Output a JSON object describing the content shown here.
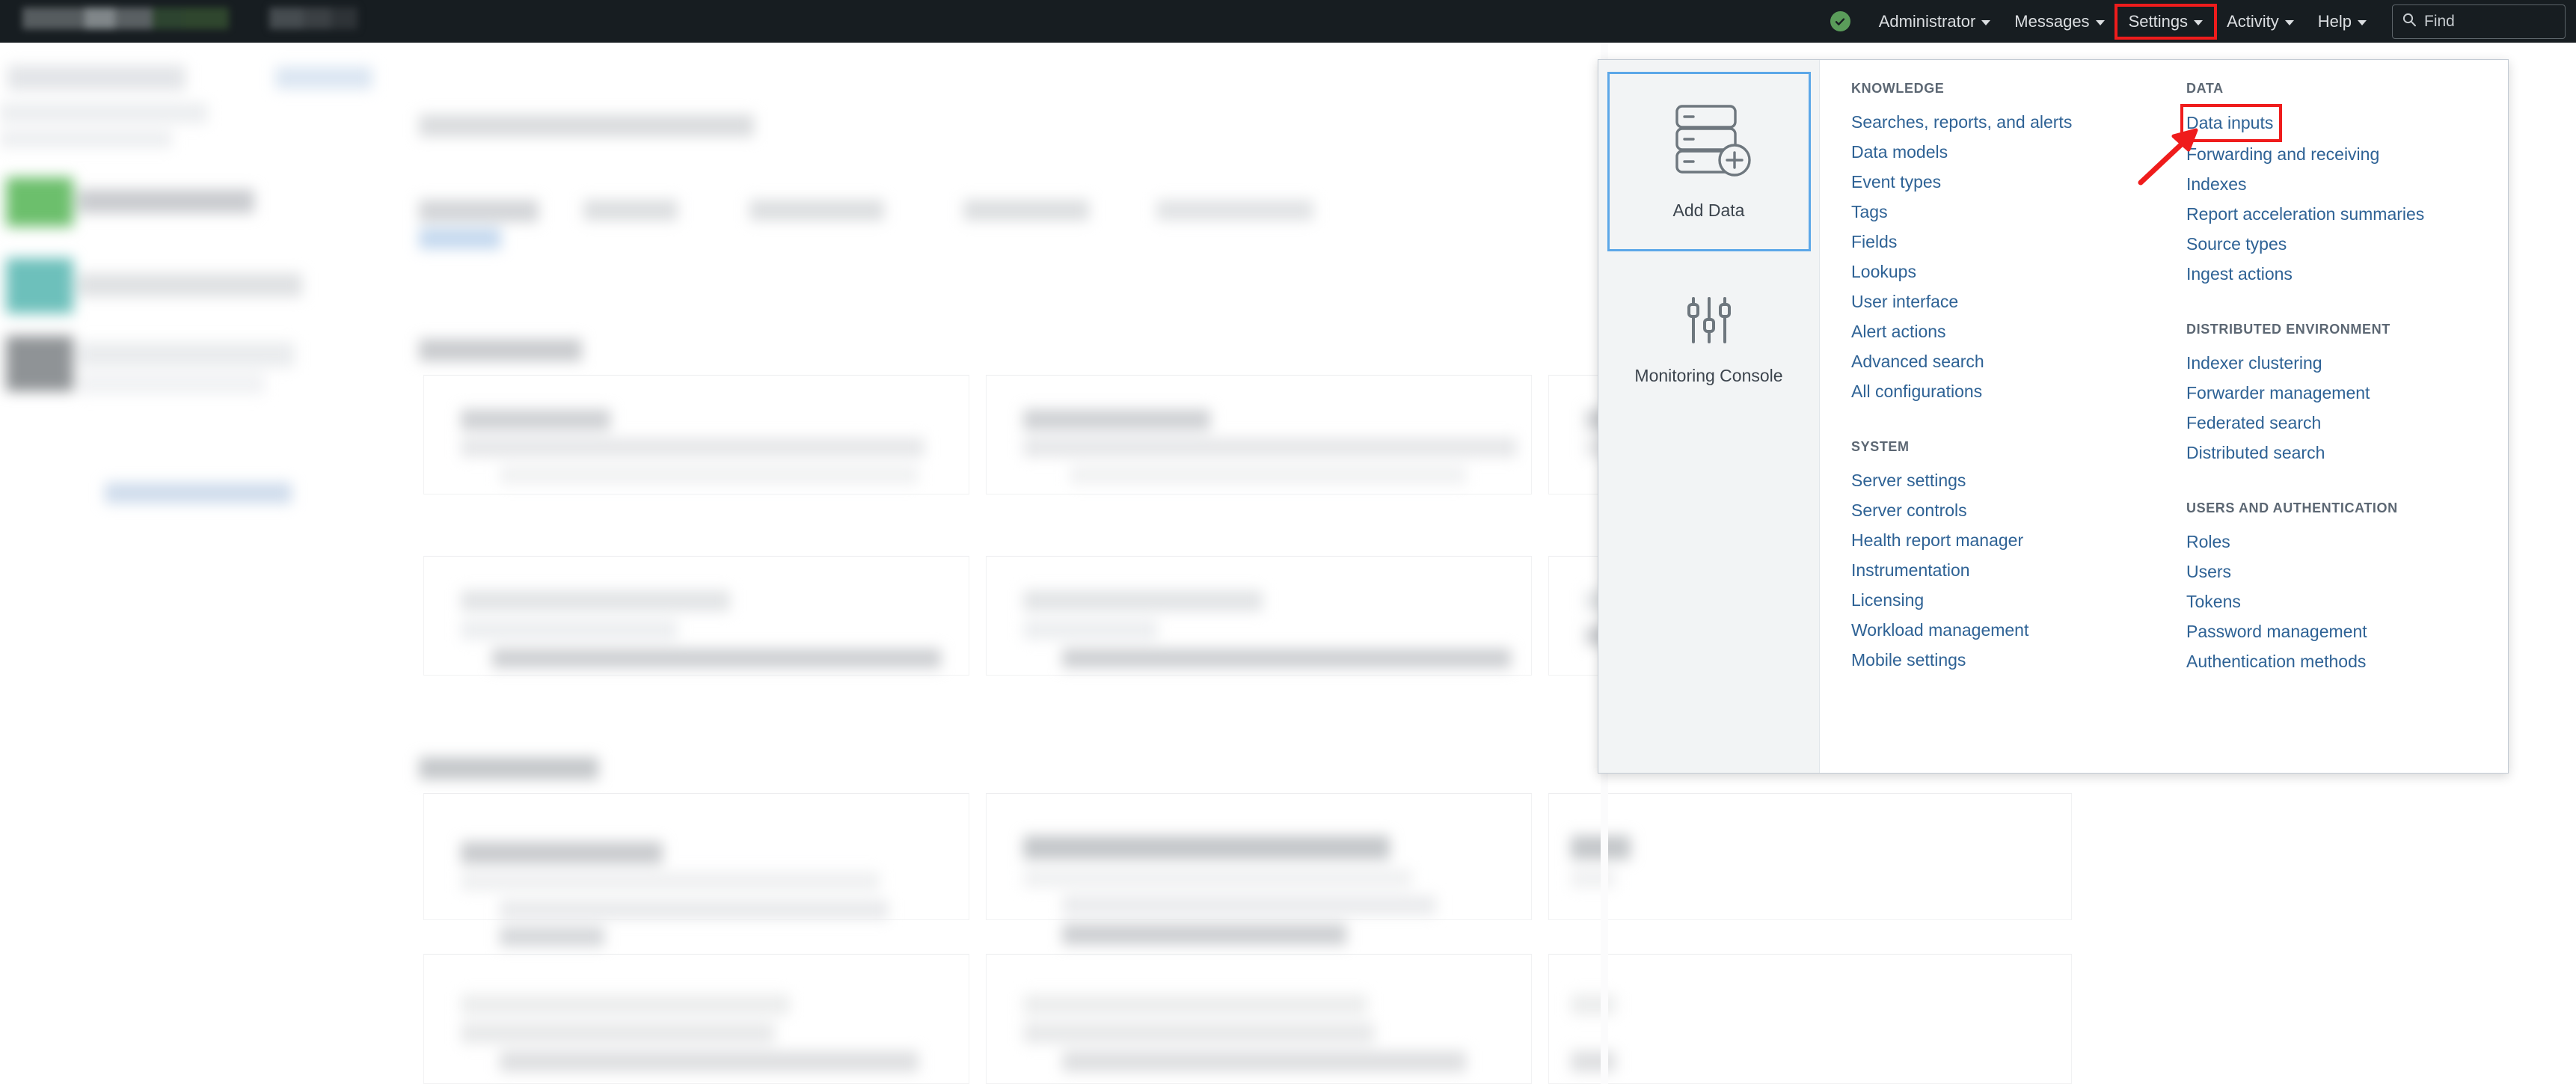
{
  "appbar": {
    "health_icon": "check-circle-icon",
    "items": [
      {
        "label": "Administrator",
        "caret": true,
        "active": false
      },
      {
        "label": "Messages",
        "caret": true,
        "active": false
      },
      {
        "label": "Settings",
        "caret": true,
        "active": true
      },
      {
        "label": "Activity",
        "caret": true,
        "active": false
      },
      {
        "label": "Help",
        "caret": true,
        "active": false
      }
    ],
    "find": {
      "icon": "search-icon",
      "placeholder": "Find",
      "value": "Find"
    },
    "accent_highlight": "#ef1c1c",
    "background": "#171d21"
  },
  "settings_menu": {
    "tiles": [
      {
        "label": "Add Data",
        "icon": "add-data-icon",
        "focused": true
      },
      {
        "label": "Monitoring Console",
        "icon": "sliders-icon",
        "focused": false
      }
    ],
    "columns": [
      {
        "sections": [
          {
            "heading": "KNOWLEDGE",
            "links": [
              "Searches, reports, and alerts",
              "Data models",
              "Event types",
              "Tags",
              "Fields",
              "Lookups",
              "User interface",
              "Alert actions",
              "Advanced search",
              "All configurations"
            ]
          },
          {
            "heading": "SYSTEM",
            "links": [
              "Server settings",
              "Server controls",
              "Health report manager",
              "Instrumentation",
              "Licensing",
              "Workload management",
              "Mobile settings"
            ]
          }
        ]
      },
      {
        "sections": [
          {
            "heading": "DATA",
            "links": [
              "Data inputs",
              "Forwarding and receiving",
              "Indexes",
              "Report acceleration summaries",
              "Source types",
              "Ingest actions"
            ],
            "highlighted": "Data inputs"
          },
          {
            "heading": "DISTRIBUTED ENVIRONMENT",
            "links": [
              "Indexer clustering",
              "Forwarder management",
              "Federated search",
              "Distributed search"
            ]
          },
          {
            "heading": "USERS AND AUTHENTICATION",
            "links": [
              "Roles",
              "Users",
              "Tokens",
              "Password management",
              "Authentication methods"
            ]
          }
        ]
      }
    ]
  },
  "annotation": {
    "arrow_icon": "red-arrow-icon",
    "color": "#ef1c1c",
    "target": "Data inputs"
  },
  "background_page": {
    "note": "obscured-dashboard-content",
    "status_colors": [
      "#6cbf6c",
      "#6dc0bb",
      "#8f9396"
    ]
  }
}
